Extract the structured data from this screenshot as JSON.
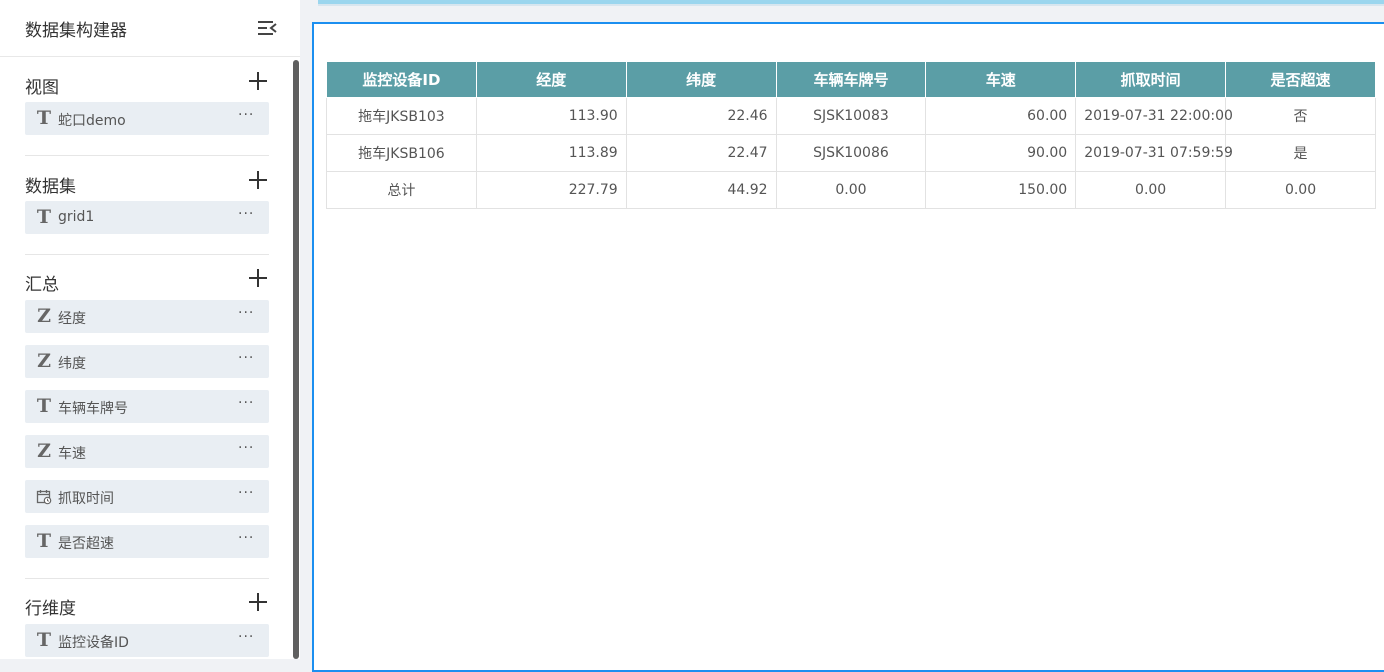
{
  "sidebar": {
    "title": "数据集构建器",
    "collapse_icon": "collapse-left-icon",
    "sections": {
      "view": {
        "title": "视图",
        "items": [
          {
            "type": "T",
            "label": "蛇口demo"
          }
        ]
      },
      "dataset": {
        "title": "数据集",
        "items": [
          {
            "type": "T",
            "label": "grid1"
          }
        ]
      },
      "summary": {
        "title": "汇总",
        "items": [
          {
            "type": "Z",
            "label": "经度"
          },
          {
            "type": "Z",
            "label": "纬度"
          },
          {
            "type": "T",
            "label": "车辆车牌号"
          },
          {
            "type": "Z",
            "label": "车速"
          },
          {
            "type": "calendar",
            "label": "抓取时间"
          },
          {
            "type": "T",
            "label": "是否超速"
          }
        ]
      },
      "row_dimension": {
        "title": "行维度",
        "items": [
          {
            "type": "T",
            "label": "监控设备ID"
          }
        ]
      }
    },
    "more_label": "···"
  },
  "table": {
    "headers": [
      "监控设备ID",
      "经度",
      "纬度",
      "车辆车牌号",
      "车速",
      "抓取时间",
      "是否超速"
    ],
    "rows": [
      {
        "device_id": "拖车JKSB103",
        "lng": "113.90",
        "lat": "22.46",
        "plate": "SJSK10083",
        "speed": "60.00",
        "time": "2019-07-31 22:00:00",
        "overspeed": "否"
      },
      {
        "device_id": "拖车JKSB106",
        "lng": "113.89",
        "lat": "22.47",
        "plate": "SJSK10086",
        "speed": "90.00",
        "time": "2019-07-31 07:59:59",
        "overspeed": "是"
      }
    ],
    "total": {
      "label": "总计",
      "lng": "227.79",
      "lat": "44.92",
      "plate": "0.00",
      "speed": "150.00",
      "time": "0.00",
      "overspeed": "0.00"
    }
  },
  "colors": {
    "header_bg": "#5b9ea6",
    "frame_border": "#1b8ff0",
    "item_bg": "#e9eef3"
  }
}
